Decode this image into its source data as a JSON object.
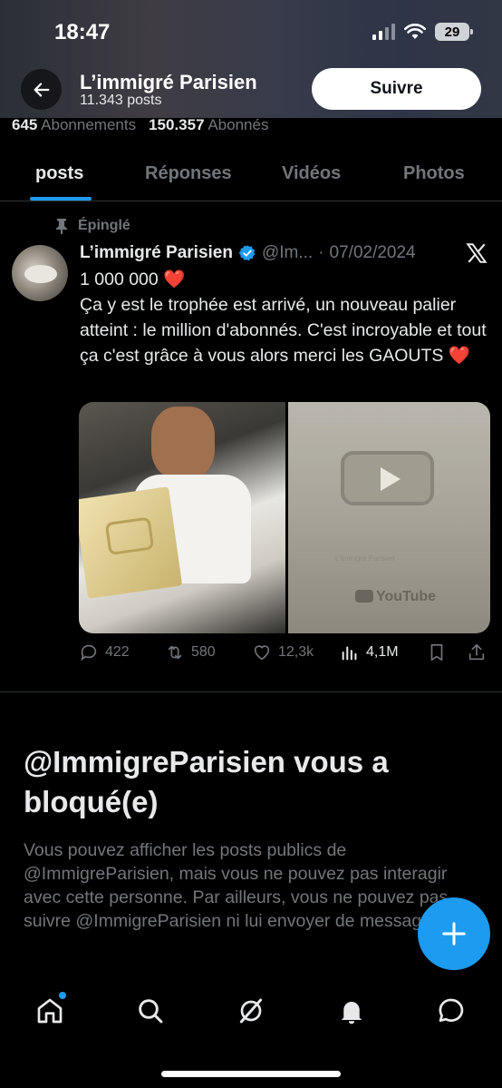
{
  "status_bar": {
    "time": "18:47",
    "battery": "29"
  },
  "header": {
    "name": "L’immigré Parisien",
    "post_count": "11.343 posts",
    "follow_label": "Suivre"
  },
  "stats": {
    "following_count": "645",
    "following_label": "Abonnements",
    "followers_count": "150.357",
    "followers_label": "Abonnés"
  },
  "tabs": [
    {
      "label": "posts",
      "active": true
    },
    {
      "label": "Réponses",
      "active": false
    },
    {
      "label": "Vidéos",
      "active": false
    },
    {
      "label": "Photos",
      "active": false
    }
  ],
  "tweet": {
    "pinned_label": "Épinglé",
    "author": "L’immigré Parisien",
    "handle": "@Im...",
    "separator": "·",
    "date": "07/02/2024",
    "line1": "1 000 000 ",
    "line2": "Ça y est le trophée est arrivé, un nouveau palier atteint : le million d'abonnés. C'est incroyable et tout ça c'est grâce à vous alors merci les GAOUTS ",
    "heart": "❤️",
    "image_caption": "L'immigré Parisien",
    "image_brand": "YouTube",
    "replies": "422",
    "reposts": "580",
    "likes": "12,3k",
    "views": "4,1M"
  },
  "blocked": {
    "title": "@ImmigreParisien vous a bloqué(e)",
    "description": "Vous pouvez afficher les posts publics de @ImmigreParisien, mais vous ne pouvez pas interagir avec cette personne. Par ailleurs, vous ne pouvez pas suivre @ImmigreParisien ni lui envoyer de messages."
  },
  "icons": {
    "back": "arrow-left-icon",
    "pin": "pin-icon",
    "verified": "verified-badge-icon",
    "x_logo": "x-logo-icon",
    "reply": "reply-icon",
    "repost": "repost-icon",
    "like": "heart-icon",
    "views": "views-icon",
    "bookmark": "bookmark-icon",
    "share": "share-icon",
    "compose": "plus-icon",
    "home": "home-icon",
    "search": "search-icon",
    "grok": "grok-icon",
    "notifications": "bell-icon",
    "messages": "messages-icon"
  },
  "colors": {
    "accent": "#1d9bf0",
    "background": "#000000",
    "muted": "#71767b",
    "text": "#e7e9ea"
  }
}
